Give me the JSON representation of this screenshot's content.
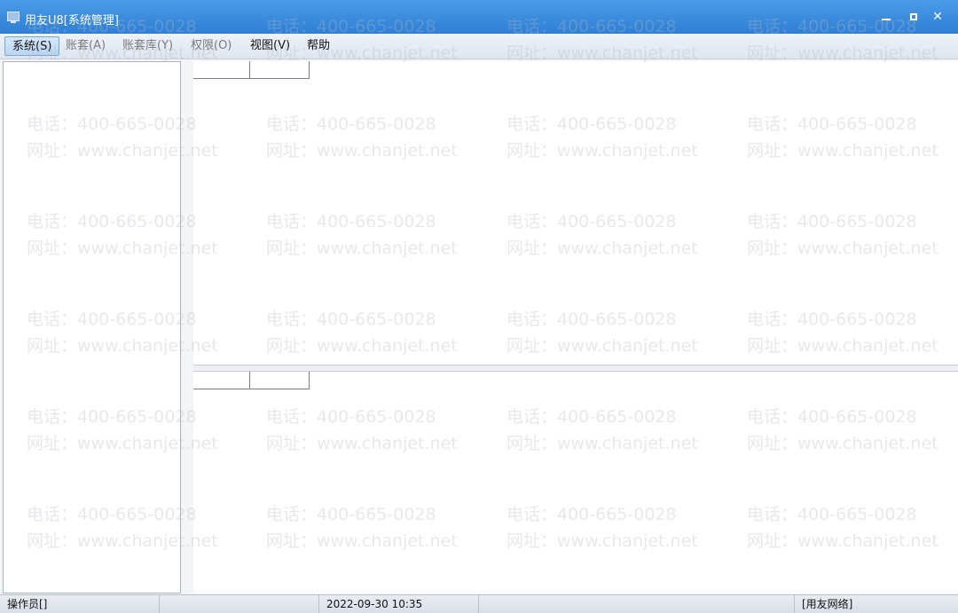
{
  "window": {
    "title": "用友U8[系统管理]",
    "controls": [
      "minimize-icon",
      "maximize-icon",
      "close-icon"
    ]
  },
  "menu": {
    "items": [
      {
        "label": "系统(S)",
        "state": "active"
      },
      {
        "label": "账套(A)",
        "state": "disabled"
      },
      {
        "label": "账套库(Y)",
        "state": "disabled"
      },
      {
        "label": "权限(O)",
        "state": "disabled"
      },
      {
        "label": "视图(V)",
        "state": "normal"
      },
      {
        "label": "帮助",
        "state": "normal"
      }
    ]
  },
  "status": {
    "operator": "操作员[]",
    "cell2": "",
    "datetime": "2022-09-30 10:35",
    "cell4": "",
    "network": "[用友网络]"
  },
  "watermark": {
    "phone": "电话：400-665-0028",
    "site": "网址：www.chanjet.net"
  },
  "colors": {
    "titlebar": "#2f7fd6",
    "menubar": "#dfe6ef",
    "panel": "#ffffff"
  }
}
